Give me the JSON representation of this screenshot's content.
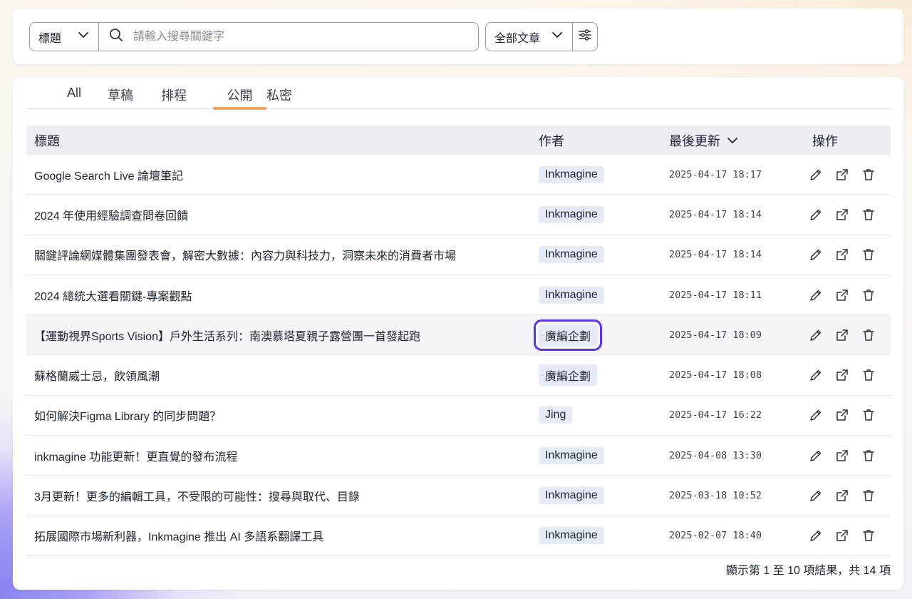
{
  "search": {
    "field_value": "標題",
    "placeholder": "請輸入搜尋關鍵字",
    "article_filter": "全部文章"
  },
  "tabs": [
    {
      "label": "All",
      "active": false
    },
    {
      "label": "草稿",
      "active": false
    },
    {
      "label": "排程",
      "active": false
    },
    {
      "label": "公開",
      "active": true
    },
    {
      "label": "私密",
      "active": false
    }
  ],
  "table": {
    "headers": {
      "title": "標題",
      "author": "作者",
      "updated": "最後更新",
      "actions": "操作"
    },
    "rows": [
      {
        "title": "Google Search Live 論壇筆記",
        "author": "Inkmagine",
        "updated": "2025-04-17 18:17"
      },
      {
        "title": "2024 年使用經驗調查問卷回饋",
        "author": "Inkmagine",
        "updated": "2025-04-17 18:14"
      },
      {
        "title": "關鍵評論網媒體集團發表會，解密大數據：內容力與科技力，洞察未來的消費者市場",
        "author": "Inkmagine",
        "updated": "2025-04-17 18:14"
      },
      {
        "title": "2024 總統大選看關鍵-專案觀點",
        "author": "Inkmagine",
        "updated": "2025-04-17 18:11"
      },
      {
        "title": "【運動視界Sports Vision】戶外生活系列：南澳慕塔夏親子露營團一首發起跑",
        "author": "廣編企劃",
        "updated": "2025-04-17 18:09"
      },
      {
        "title": "蘇格蘭威士忌，飲領風潮",
        "author": "廣編企劃",
        "updated": "2025-04-17 18:08"
      },
      {
        "title": "如何解決Figma Library 的同步問題？",
        "author": "Jing",
        "updated": "2025-04-17 16:22"
      },
      {
        "title": "inkmagine 功能更新！更直覺的發布流程",
        "author": "Inkmagine",
        "updated": "2025-04-08 13:30"
      },
      {
        "title": "3月更新！更多的編輯工具，不受限的可能性：搜尋與取代、目錄",
        "author": "Inkmagine",
        "updated": "2025-03-18 10:52"
      },
      {
        "title": "拓展國際市場新利器，Inkmagine 推出 AI 多語系翻譯工具",
        "author": "Inkmagine",
        "updated": "2025-02-07 18:40"
      }
    ]
  },
  "pagination": {
    "summary": "顯示第 1 至 10 項結果，共 14 項"
  },
  "icons": [
    "chevron-down-icon",
    "search-icon",
    "filter-sliders-icon",
    "edit-icon",
    "external-link-icon",
    "trash-icon"
  ],
  "colors": {
    "active_tab_underline": "#f0a45d",
    "author_badge": "#e5eaf6",
    "focus_outline": "#5b35e0"
  }
}
